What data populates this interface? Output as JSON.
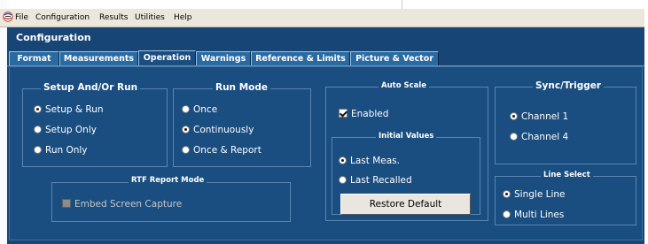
{
  "menubar": {
    "items": [
      "File",
      "Configuration",
      "Results",
      "Utilities",
      "Help"
    ]
  },
  "window": {
    "title": "Configuration"
  },
  "tabs": [
    {
      "label": "Format",
      "active": false
    },
    {
      "label": "Measurements",
      "active": false
    },
    {
      "label": "Operation",
      "active": true
    },
    {
      "label": "Warnings",
      "active": false
    },
    {
      "label": "Reference & Limits",
      "active": false
    },
    {
      "label": "Picture & Vector",
      "active": false
    }
  ],
  "setup_group": {
    "title": "Setup And/Or Run",
    "options": [
      {
        "label": "Setup & Run",
        "selected": true
      },
      {
        "label": "Setup Only",
        "selected": false
      },
      {
        "label": "Run Only",
        "selected": false
      }
    ]
  },
  "run_mode_group": {
    "title": "Run Mode",
    "options": [
      {
        "label": "Once",
        "selected": false
      },
      {
        "label": "Continuously",
        "selected": true
      },
      {
        "label": "Once & Report",
        "selected": false
      }
    ]
  },
  "rtf_group": {
    "title": "RTF Report Mode",
    "embed_label": "Embed Screen Capture",
    "embed_checked": false,
    "embed_enabled": false
  },
  "auto_scale_group": {
    "title": "Auto Scale",
    "enabled_label": "Enabled",
    "enabled_checked": true,
    "initial_values": {
      "title": "Initial Values",
      "options": [
        {
          "label": "Last Meas.",
          "selected": true
        },
        {
          "label": "Last Recalled",
          "selected": false
        }
      ]
    },
    "restore_button": "Restore Default"
  },
  "sync_group": {
    "title": "Sync/Trigger",
    "options": [
      {
        "label": "Channel 1",
        "selected": true
      },
      {
        "label": "Channel 4",
        "selected": false
      }
    ]
  },
  "line_select_group": {
    "title": "Line Select",
    "options": [
      {
        "label": "Single Line",
        "selected": true
      },
      {
        "label": "Multi Lines",
        "selected": false
      }
    ]
  },
  "colors": {
    "panel": "#174575",
    "content": "#1a4d80",
    "tab": "#2a6aa3",
    "menubar": "#ebe7dc"
  }
}
